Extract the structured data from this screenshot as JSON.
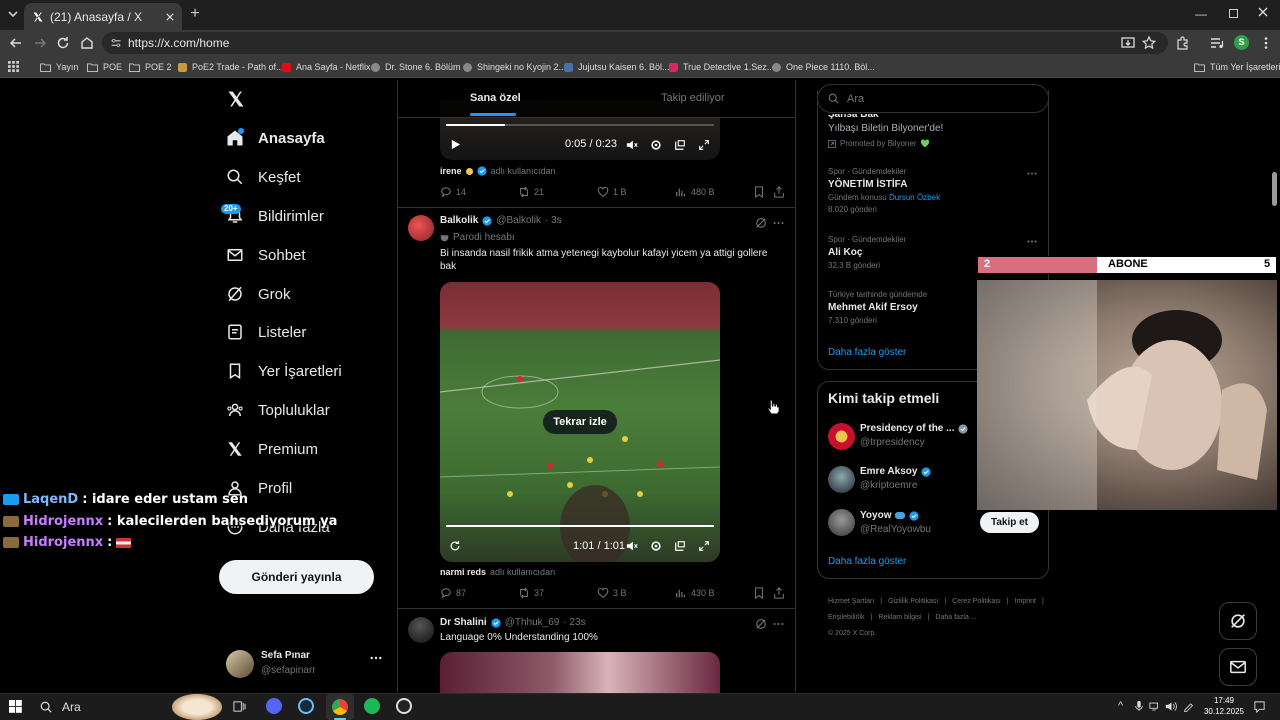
{
  "browser": {
    "tab_title": "(21) Anasayfa / X",
    "url": "https://x.com/home",
    "bookmarks": [
      "Yayın",
      "POE",
      "POE 2",
      "PoE2 Trade - Path of...",
      "Ana Sayfa - Netflix",
      "Dr. Stone 6. Bölüm",
      "Shingeki no Kyojin 2...",
      "Jujutsu Kaisen 6. Böl...",
      "True Detective 1.Sez...",
      "One Piece 1110. Böl..."
    ],
    "all_bookmarks": "Tüm Yer İşaretleri",
    "profile_initial": "S"
  },
  "nav": {
    "items": [
      "Anasayfa",
      "Keşfet",
      "Bildirimler",
      "Sohbet",
      "Grok",
      "Listeler",
      "Yer İşaretleri",
      "Topluluklar",
      "Premium",
      "Profil",
      "Daha fazla"
    ],
    "notif_badge": "20+",
    "post_button": "Gönderi yayınla",
    "account_name": "Sefa Pınar",
    "account_handle": "@sefapinarr"
  },
  "timeline": {
    "tabs": [
      "Sana özel",
      "Takip ediliyor"
    ],
    "post0": {
      "time": "0:05 / 0:23",
      "attribution_name": "irene",
      "attribution_suffix": "adlı kullanıcıdan",
      "replies": "14",
      "reposts": "21",
      "likes": "1 B",
      "views": "480 B"
    },
    "post1": {
      "name": "Balkolik",
      "handle": "@Balkolik",
      "ago": "· 3s",
      "label": "Parodi hesabı",
      "text": "Bi insanda nasil frikik atma yetenegi kaybolur kafayi yicem ya attigi gollere bak",
      "replay": "Tekrar izle",
      "time": "1:01 / 1:01",
      "attribution_name": "narmi reds",
      "attribution_suffix": "adlı kullanıcıdan",
      "replies": "87",
      "reposts": "37",
      "likes": "3 B",
      "views": "430 B"
    },
    "post2": {
      "name": "Dr Shalini",
      "handle": "@Thhuk_69",
      "ago": "· 23s",
      "text": "Language 0% Understanding 100%"
    }
  },
  "right": {
    "search_placeholder": "Ara",
    "ad_title_partial": "Şansa Bak",
    "ad_line": "Yılbaşı Biletin Bilyoner'de!",
    "ad_promoted": "Promoted by Bilyoner",
    "trends": [
      {
        "meta": "Spor · Gündemdekiler",
        "title": "YÖNETİM İSTİFA",
        "sub_prefix": "Gündem konusu",
        "sub_link": "Dursun Özbek",
        "count": "8.020 gönderi"
      },
      {
        "meta": "Spor · Gündemdekiler",
        "title": "Ali Koç",
        "count": "32,3 B gönderi"
      },
      {
        "meta": "Türkiye tarihinde gündemde",
        "title": "Mehmet Akif Ersoy",
        "count": "7.310 gönderi"
      }
    ],
    "show_more": "Daha fazla göster",
    "who_title": "Kimi takip etmeli",
    "who": [
      {
        "name": "Presidency of the ...",
        "handle": "@trpresidency"
      },
      {
        "name": "Emre Aksoy",
        "handle": "@kriptoemre"
      },
      {
        "name": "Yoyow",
        "handle": "@RealYoyowbu"
      }
    ],
    "follow": "Takip et",
    "footer": [
      "Hizmet Şartları",
      "|",
      "Gizlilik Politikası",
      "|",
      "Çerez Politikası",
      "|",
      "Imprint",
      "|",
      "Erişilebilirlik",
      "|",
      "Reklam bilgisi",
      "|",
      "Daha fazla ...",
      "© 2025 X Corp."
    ]
  },
  "overlay": {
    "sub_left": "2",
    "sub_label": "ABONE",
    "sub_right": "5",
    "sub_progress": 0.4,
    "chat": [
      {
        "user": "LaqenD",
        "msg": ": idare eder ustam sen"
      },
      {
        "user": "Hidrojennx",
        "msg": ": kalecilerden bahsediyorum ya"
      },
      {
        "user": "Hidrojennx",
        "msg": ":"
      }
    ]
  },
  "taskbar": {
    "search": "Ara",
    "time": "17:49",
    "date": "30.12.2025"
  },
  "colors": {
    "accent": "#1d9bf0",
    "bg": "#000000",
    "chat_user": "#c77dff"
  }
}
